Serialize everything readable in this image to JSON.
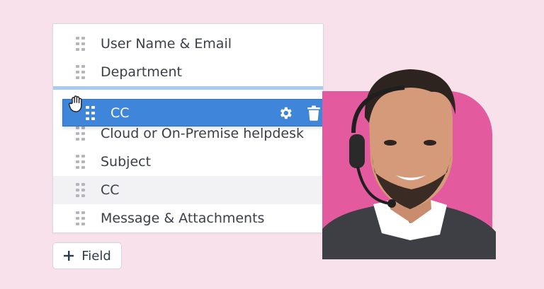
{
  "form_fields": {
    "rows": [
      {
        "label": "User Name & Email"
      },
      {
        "label": "Department"
      },
      {
        "label": "Cloud or On-Premise helpdesk"
      },
      {
        "label": "Subject"
      },
      {
        "label": "CC"
      },
      {
        "label": "Message & Attachments"
      }
    ],
    "dragging_label": "CC"
  },
  "add_field_button": {
    "icon": "plus-icon",
    "label": "Field"
  },
  "icons": {
    "drag_handle": "drag-handle-icon",
    "settings": "gear-icon",
    "delete": "trash-icon",
    "cursor": "grab-hand-icon"
  },
  "colors": {
    "background": "#f8e1ea",
    "accent_blue": "#3f86da",
    "drop_indicator": "#a8cbef",
    "photo_backdrop": "#e35a9e",
    "text": "#3b3f47"
  }
}
